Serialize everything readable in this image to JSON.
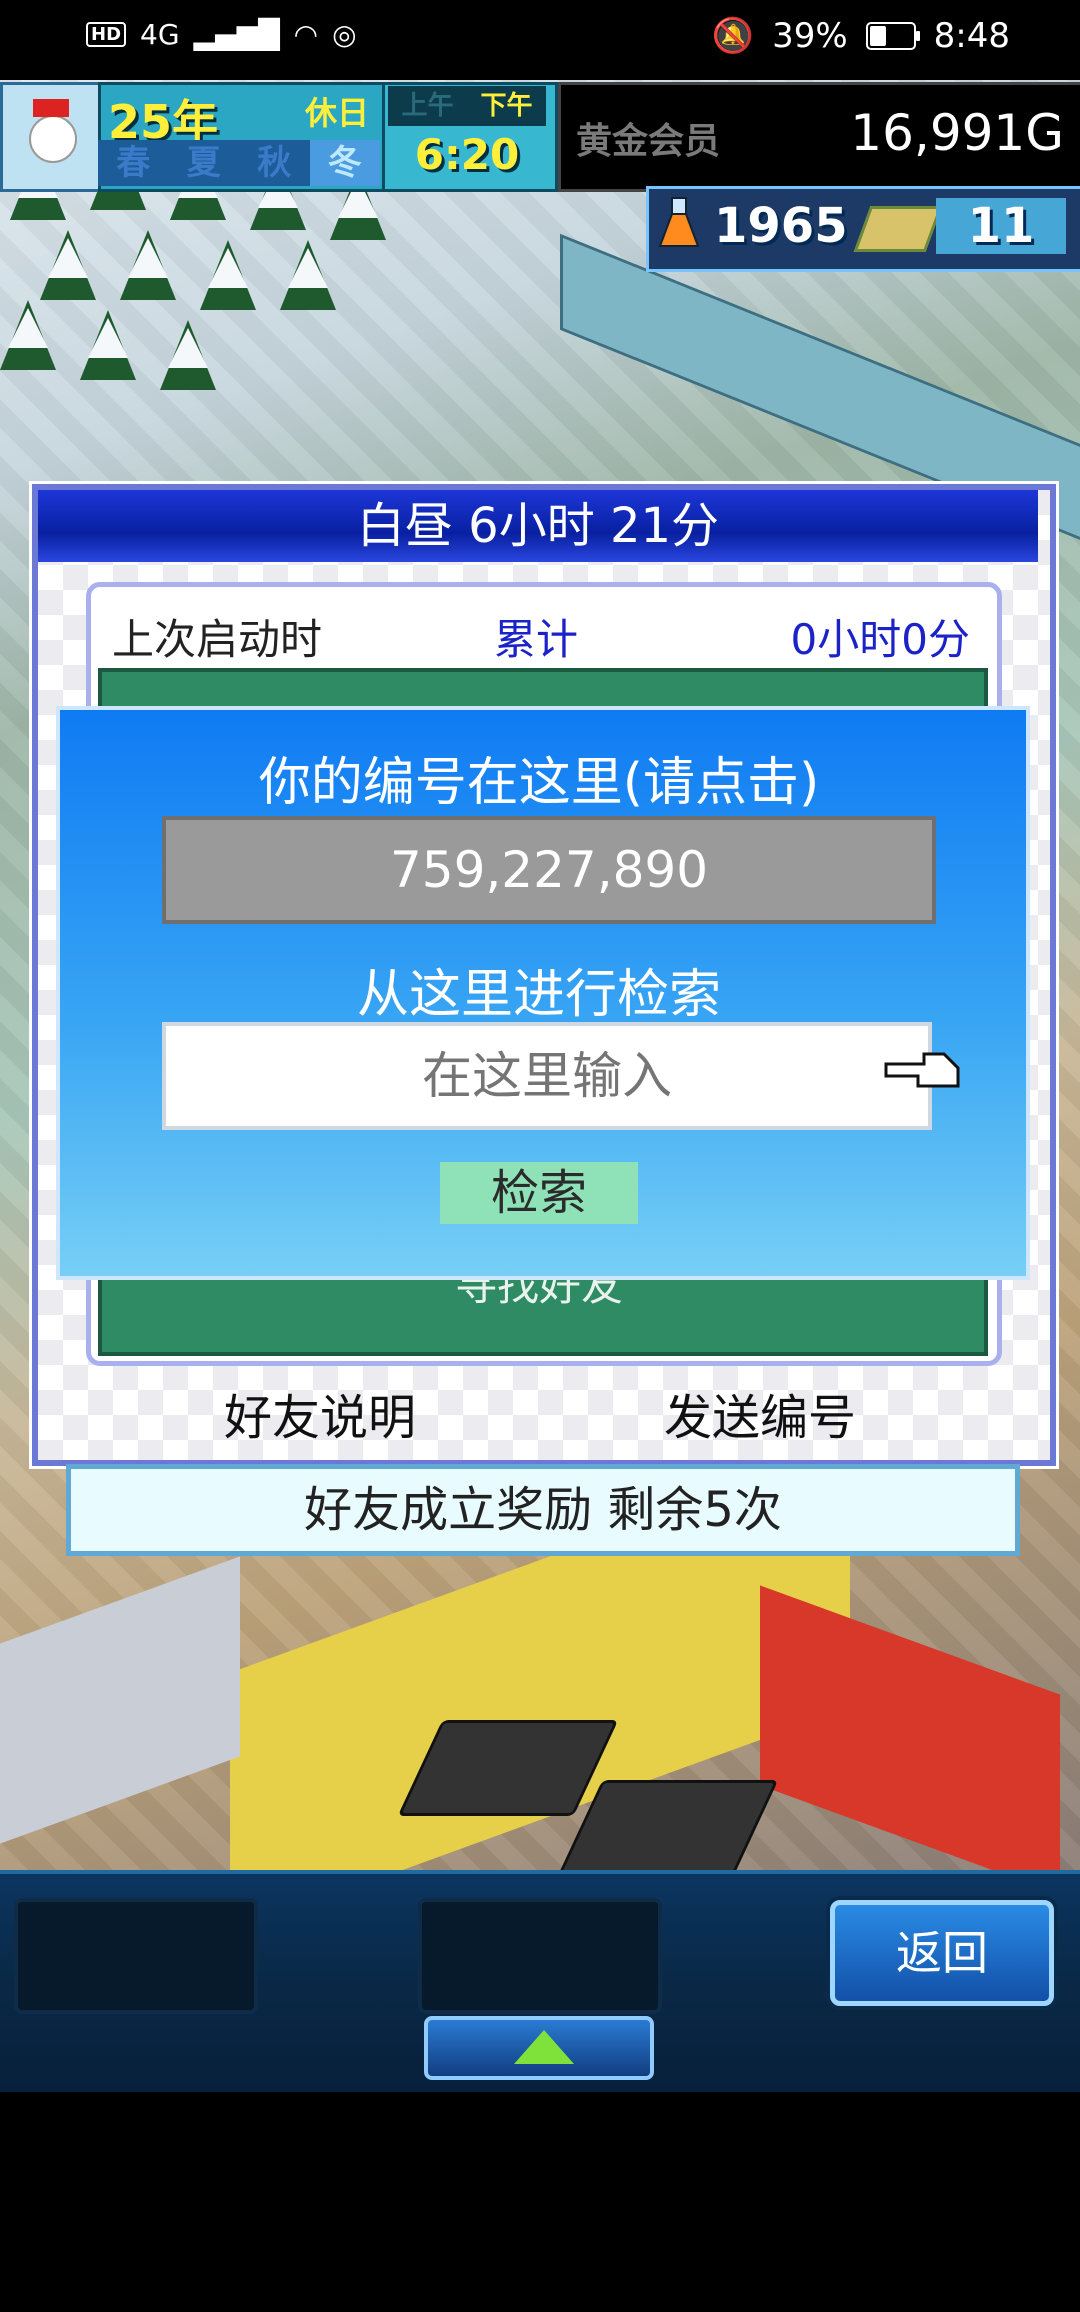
{
  "status_bar": {
    "hd_label": "HD",
    "network": "4G",
    "battery_percent": "39%",
    "time": "8:48"
  },
  "hud": {
    "year": "25",
    "year_unit": "年",
    "holiday": "休日",
    "seasons": [
      "春",
      "夏",
      "秋",
      "冬"
    ],
    "active_season": "冬",
    "am_label": "上午",
    "pm_label": "下午",
    "clock": "6:20",
    "membership": "黄金会员",
    "money": "16,991G",
    "research_points": "1965",
    "tickets": "11"
  },
  "panel": {
    "title": "白昼  6小时 21分",
    "last_launch_label": "上次启动时",
    "total_label": "累计",
    "total_value": "0小时0分",
    "find_friend_label": "寻找好友",
    "friend_explain_button": "好友说明",
    "send_id_button": "发送编号",
    "reward_text": "好友成立奖励  剩余5次"
  },
  "dialog": {
    "id_title": "你的编号在这里(请点击)",
    "id_value": "759,227,890",
    "search_title": "从这里进行检索",
    "search_placeholder": "在这里输入",
    "search_button": "检索"
  },
  "bottom": {
    "back_button": "返回"
  },
  "colors": {
    "dialog_top": "#0f7bf3",
    "dialog_bottom": "#77cff5",
    "panel_title_bg": "#1d36d8",
    "money_text": "#ffffff",
    "hud_yellow": "#ffef3a"
  }
}
